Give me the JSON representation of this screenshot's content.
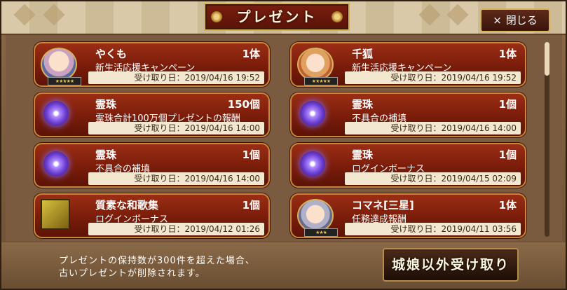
{
  "header": {
    "title": "プレゼント",
    "close_label": "閉じる",
    "close_icon": "×"
  },
  "items": [
    {
      "name": "やくも",
      "qty": "1体",
      "desc": "新生活応援キャンペーン",
      "date": "受け取り日：2019/04/16 19:52",
      "icon": "character-avatar"
    },
    {
      "name": "千狐",
      "qty": "1体",
      "desc": "新生活応援キャンペーン",
      "date": "受け取り日：2019/04/16 19:52",
      "icon": "character-avatar"
    },
    {
      "name": "霊珠",
      "qty": "150個",
      "desc": "霊珠合計100万個プレゼントの報酬",
      "date": "受け取り日：2019/04/16 14:00",
      "icon": "spirit-orb"
    },
    {
      "name": "霊珠",
      "qty": "1個",
      "desc": "不具合の補填",
      "date": "受け取り日：2019/04/16 14:00",
      "icon": "spirit-orb"
    },
    {
      "name": "霊珠",
      "qty": "1個",
      "desc": "不具合の補填",
      "date": "受け取り日：2019/04/16 14:00",
      "icon": "spirit-orb"
    },
    {
      "name": "霊珠",
      "qty": "1個",
      "desc": "ログインボーナス",
      "date": "受け取り日：2019/04/15 02:09",
      "icon": "spirit-orb"
    },
    {
      "name": "質素な和歌集",
      "qty": "1個",
      "desc": "ログインボーナス",
      "date": "受け取り日：2019/04/12 01:26",
      "icon": "poetry-book"
    },
    {
      "name": "コマネ[三星]",
      "qty": "1体",
      "desc": "任務達成報酬",
      "date": "受け取り日：2019/04/11 03:56",
      "icon": "character-avatar"
    }
  ],
  "notice": {
    "line1": "プレゼントの保持数が300件を超えた場合、",
    "line2": "古いプレゼントが削除されます。"
  },
  "receive_button": "城娘以外受け取り"
}
